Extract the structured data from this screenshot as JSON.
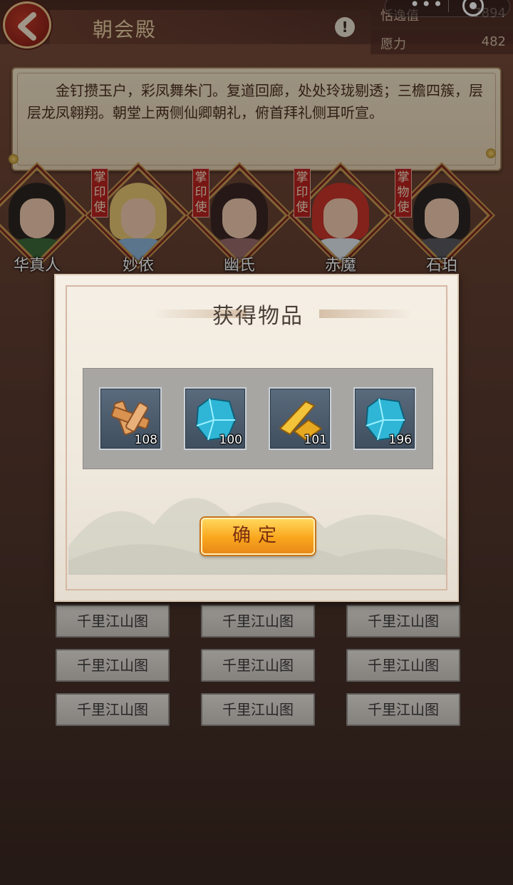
{
  "header": {
    "title": "朝会殿",
    "stats": [
      {
        "label": "恬逸值",
        "value": "7894"
      },
      {
        "label": "愿力",
        "value": "482"
      }
    ]
  },
  "description": "金钉攒玉户，彩凤舞朱门。复道回廊，处处玲珑剔透；三檐四簇，层层龙凤翱翔。朝堂上两侧仙卿朝礼，俯首拜礼侧耳听宣。",
  "characters": [
    {
      "name": "华真人",
      "seal": "",
      "hair_color": "#2a2420",
      "cloth_color": "#3c6b3a"
    },
    {
      "name": "妙依",
      "seal": "掌印使",
      "hair_color": "#e8c673",
      "cloth_color": "#8ab4d8"
    },
    {
      "name": "幽氏",
      "seal": "掌印使",
      "hair_color": "#3a2622",
      "cloth_color": "#9a6a6a"
    },
    {
      "name": "赤魔",
      "seal": "掌印使",
      "hair_color": "#c8352a",
      "cloth_color": "#dfe6ee"
    },
    {
      "name": "石珀",
      "seal": "掌物使",
      "hair_color": "#2a2624",
      "cloth_color": "#5a5a60"
    }
  ],
  "background_buttons": [
    [
      "千里江山图",
      "千里江山图",
      "千里江山图"
    ],
    [
      "千里江山图",
      "千里江山图",
      "千里江山图"
    ],
    [
      "千里江山图",
      "千里江山图",
      "千里江山图"
    ]
  ],
  "dialog": {
    "title": "获得物品",
    "items": [
      {
        "icon": "wood-puzzle-icon",
        "count": "108"
      },
      {
        "icon": "blue-crystal-icon",
        "count": "100"
      },
      {
        "icon": "gold-bar-icon",
        "count": "101"
      },
      {
        "icon": "blue-crystal-icon",
        "count": "196"
      }
    ],
    "confirm_label": "确定"
  }
}
